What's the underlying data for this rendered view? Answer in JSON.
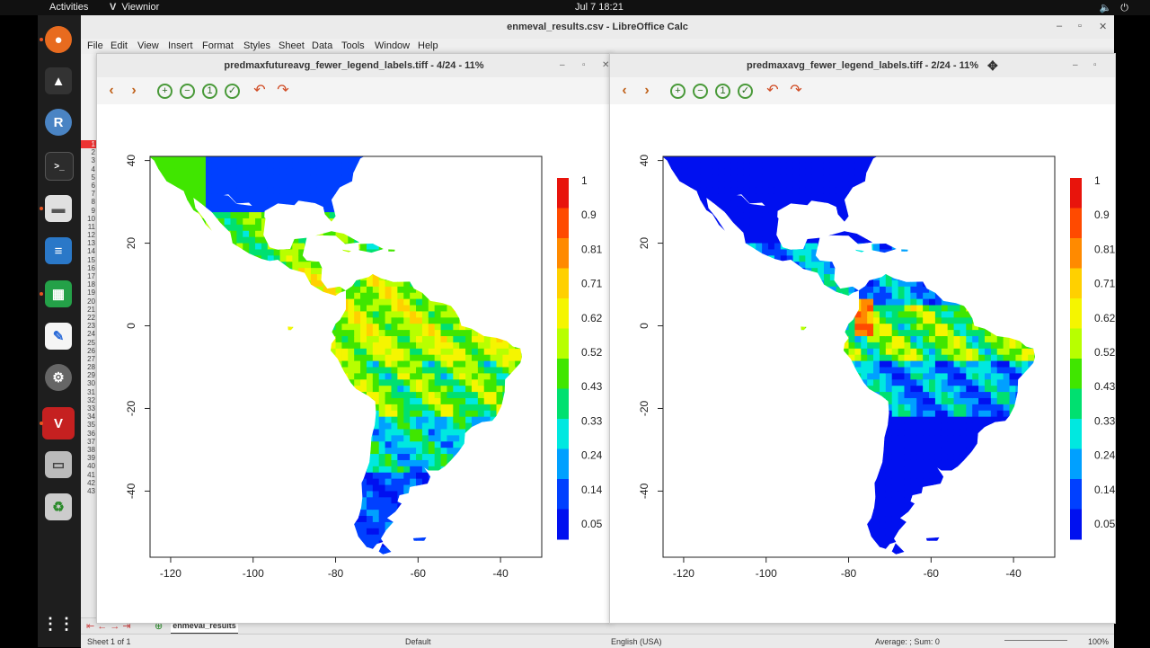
{
  "topbar": {
    "activities": "Activities",
    "app_name": "Viewnior",
    "clock": "Jul 7  18:21"
  },
  "calc": {
    "title": "enmeval_results.csv - LibreOffice Calc",
    "menu": [
      "File",
      "Edit",
      "View",
      "Insert",
      "Format",
      "Styles",
      "Sheet",
      "Data",
      "Tools",
      "Window",
      "Help"
    ],
    "row_numbers": [
      "1",
      "2",
      "3",
      "4",
      "5",
      "6",
      "7",
      "8",
      "9",
      "10",
      "11",
      "12",
      "13",
      "14",
      "15",
      "16",
      "17",
      "18",
      "19",
      "20",
      "21",
      "22",
      "23",
      "24",
      "25",
      "26",
      "27",
      "28",
      "29",
      "30",
      "31",
      "32",
      "33",
      "34",
      "35",
      "36",
      "37",
      "38",
      "39",
      "40",
      "41",
      "42",
      "43"
    ],
    "sheet_tab": "enmeval_results",
    "status": {
      "sheet": "Sheet 1 of 1",
      "style": "Default",
      "lang": "English (USA)",
      "sum": "Average: ; Sum: 0",
      "zoom": "100%"
    }
  },
  "viewers": [
    {
      "title": "predmaxfutureavg_fewer_legend_labels.tiff - 4/24 - 11%",
      "palette": "future"
    },
    {
      "title": "predmaxavg_fewer_legend_labels.tiff - 2/24 - 11%",
      "palette": "current"
    }
  ],
  "chart_data": [
    {
      "type": "heatmap",
      "title": "",
      "x_ticks": [
        -120,
        -100,
        -80,
        -60,
        -40
      ],
      "y_ticks": [
        40,
        20,
        0,
        -20,
        -40
      ],
      "xlim": [
        -125,
        -30
      ],
      "ylim": [
        -56,
        41
      ],
      "legend_labels": [
        "1",
        "0.9",
        "0.81",
        "0.71",
        "0.62",
        "0.52",
        "0.43",
        "0.33",
        "0.24",
        "0.14",
        "0.05"
      ],
      "legend_colors": [
        "#e8140c",
        "#ff4a00",
        "#ff8a00",
        "#ffd000",
        "#f5f500",
        "#b8ff00",
        "#40e600",
        "#00e070",
        "#00e8e0",
        "#00a0ff",
        "#0040ff",
        "#0010f0"
      ],
      "legend_placement": "right"
    },
    {
      "type": "heatmap",
      "title": "",
      "x_ticks": [
        -120,
        -100,
        -80,
        -60,
        -40
      ],
      "y_ticks": [
        40,
        20,
        0,
        -20,
        -40
      ],
      "xlim": [
        -125,
        -30
      ],
      "ylim": [
        -56,
        41
      ],
      "legend_labels": [
        "1",
        "0.9",
        "0.81",
        "0.71",
        "0.62",
        "0.52",
        "0.43",
        "0.33",
        "0.24",
        "0.14",
        "0.05"
      ],
      "legend_colors": [
        "#e8140c",
        "#ff4a00",
        "#ff8a00",
        "#ffd000",
        "#f5f500",
        "#b8ff00",
        "#40e600",
        "#00e070",
        "#00e8e0",
        "#00a0ff",
        "#0040ff",
        "#0010f0"
      ],
      "legend_placement": "right"
    }
  ]
}
